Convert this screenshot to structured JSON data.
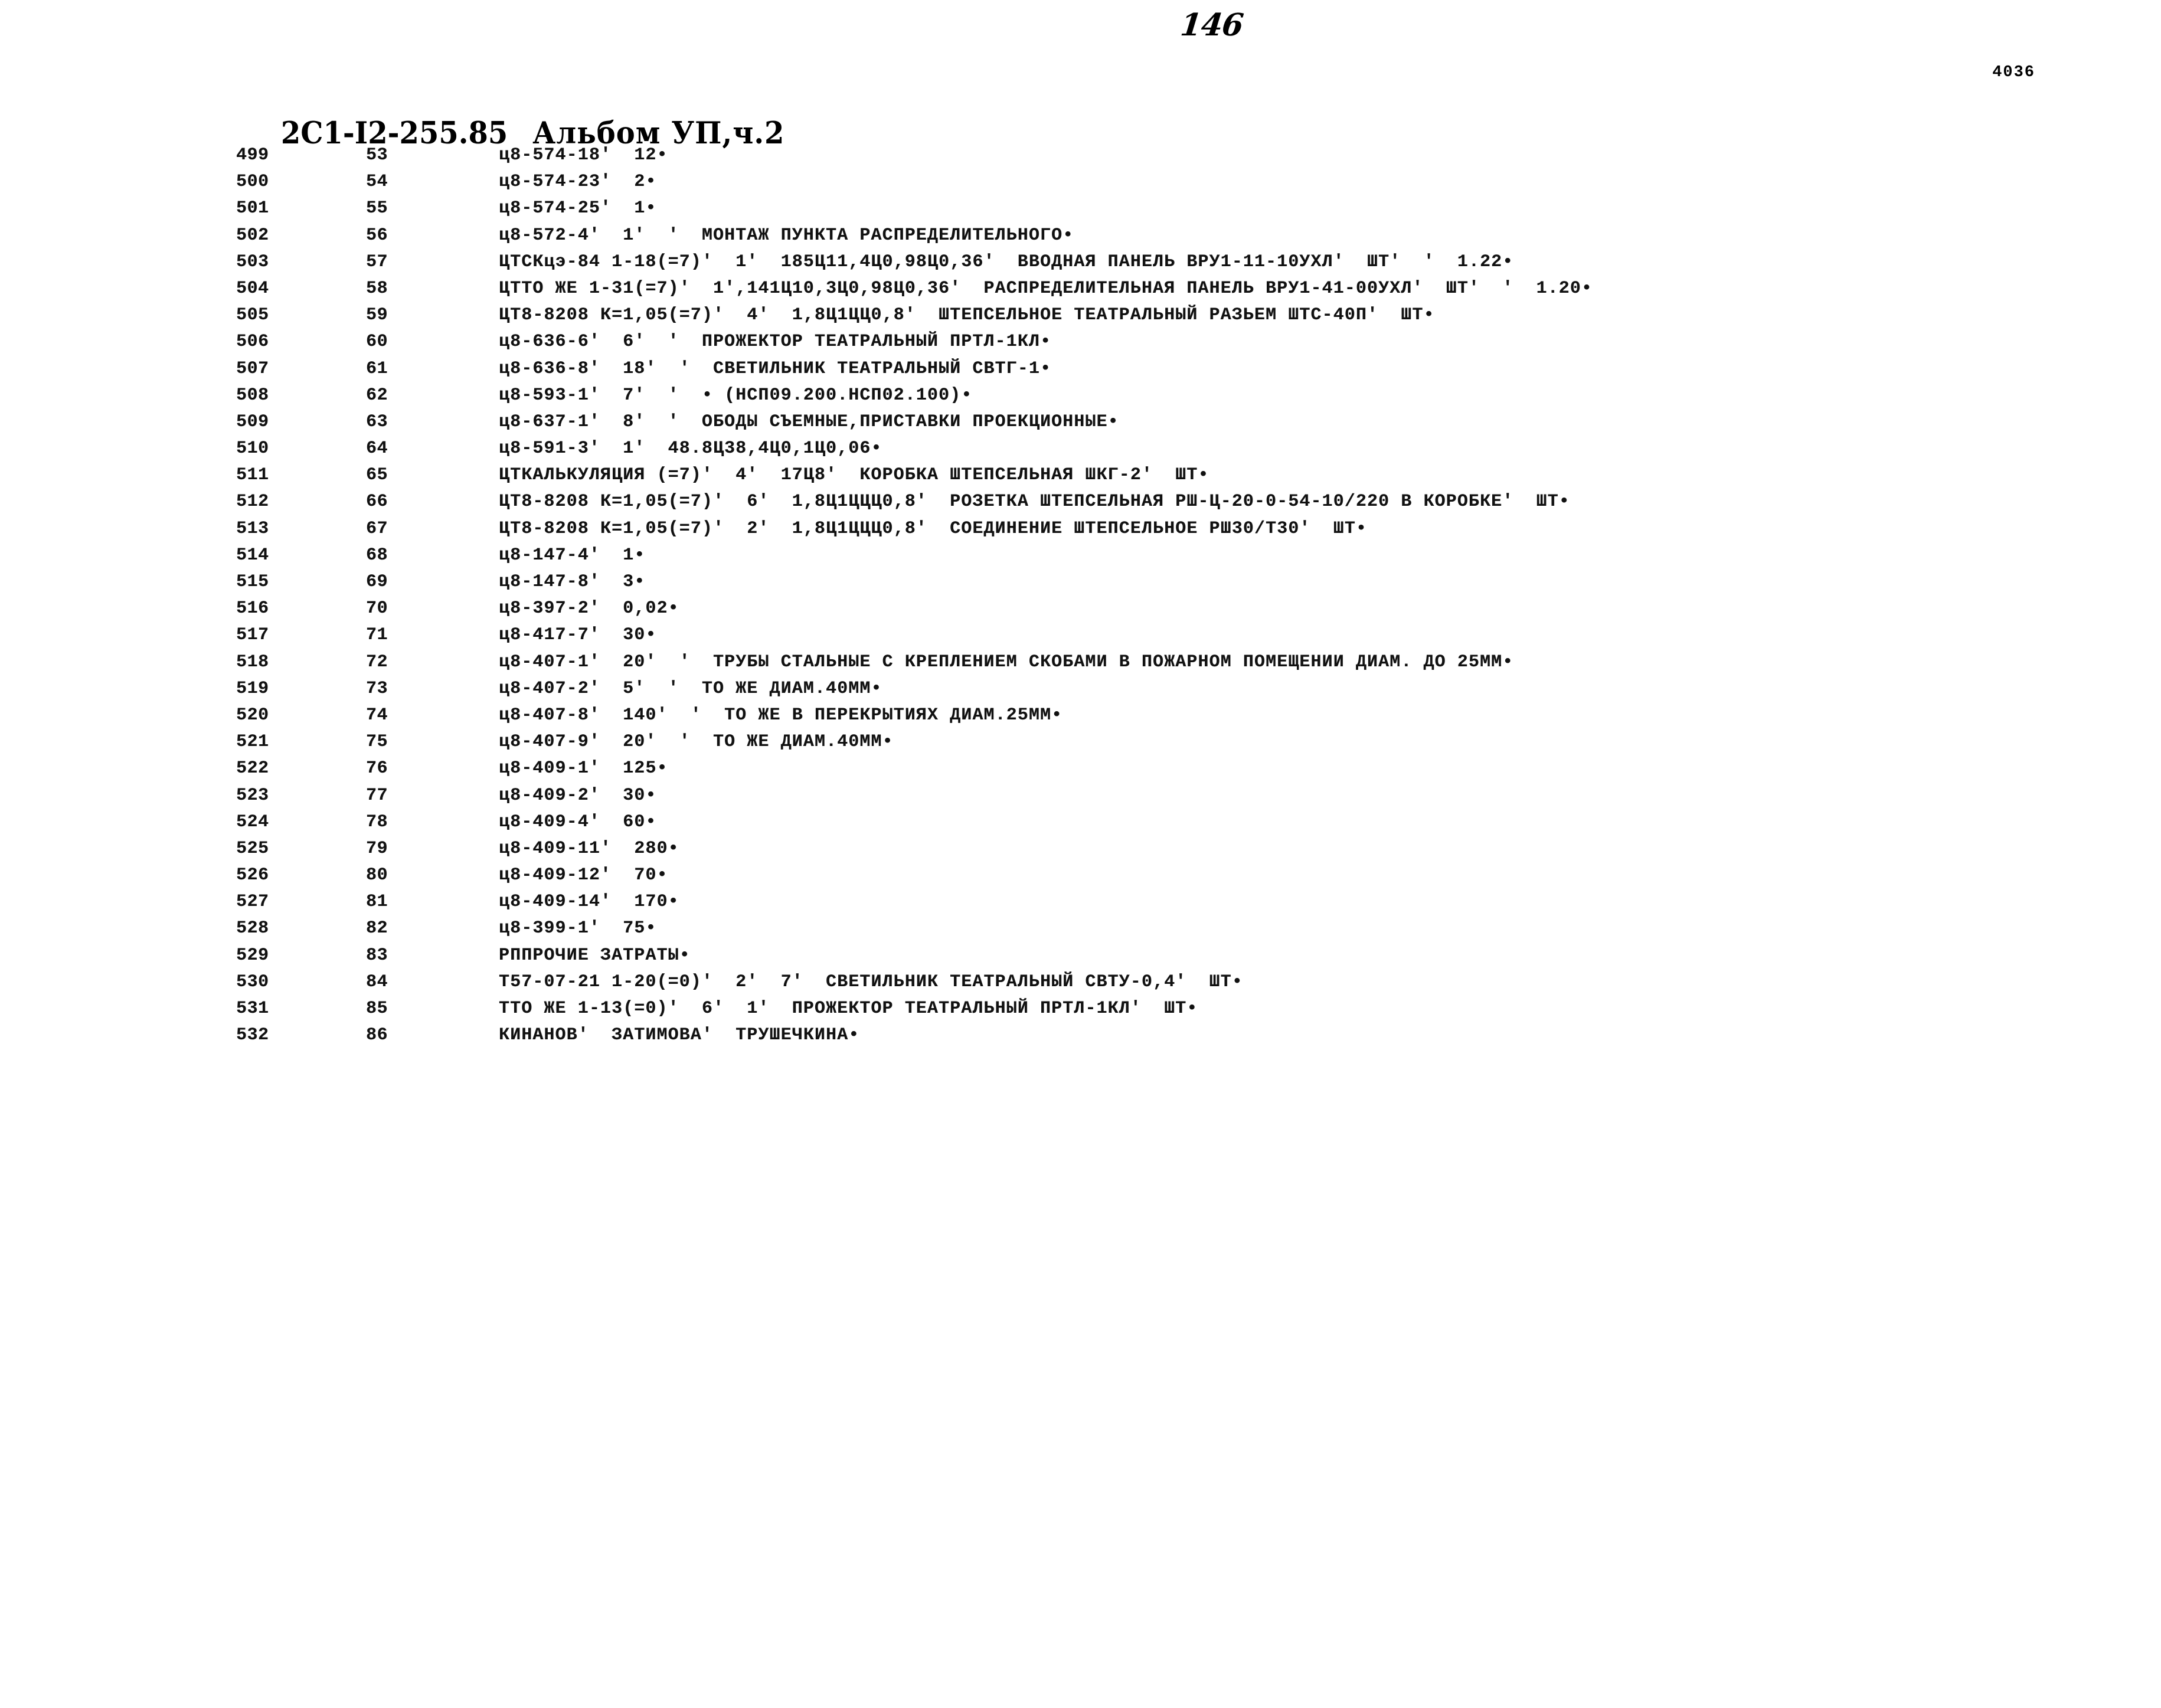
{
  "document": {
    "title_code": "2С1-I2-255.85",
    "title_album": "Альбом УП,ч.2",
    "page_number_handwritten": "146",
    "corner_code": "4036"
  },
  "listing": {
    "rows": [
      {
        "seq": "499",
        "num": "53",
        "text": "ц8-574-18'  12•"
      },
      {
        "seq": "500",
        "num": "54",
        "text": "ц8-574-23'  2•"
      },
      {
        "seq": "501",
        "num": "55",
        "text": "ц8-574-25'  1•"
      },
      {
        "seq": "502",
        "num": "56",
        "text": "ц8-572-4'  1'  '  МОНТАЖ ПУНКТА РАСПРЕДЕЛИТЕЛЬНОГО•"
      },
      {
        "seq": "503",
        "num": "57",
        "text": "ЦТСКцэ-84 1-18(=7)'  1'  185Ц11,4Ц0,98Ц0,36'  ВВОДНАЯ ПАНЕЛЬ ВРУ1-11-10УХЛ'  ШТ'  '  1.22•"
      },
      {
        "seq": "504",
        "num": "58",
        "text": "ЦТТО ЖЕ 1-31(=7)'  1',141Ц10,3Ц0,98Ц0,36'  РАСПРЕДЕЛИТЕЛЬНАЯ ПАНЕЛЬ ВРУ1-41-00УХЛ'  ШТ'  '  1.20•"
      },
      {
        "seq": "505",
        "num": "59",
        "text": "ЦТ8-8208 К=1,05(=7)'  4'  1,8Ц1ЦЦ0,8'  ШТЕПСЕЛЬНОЕ ТЕАТРАЛЬНЫЙ РАЗЬЕМ ШТС-40П'  ШТ•"
      },
      {
        "seq": "506",
        "num": "60",
        "text": "ц8-636-6'  6'  '  ПРОЖЕКТОР ТЕАТРАЛЬНЫЙ ПРТЛ-1КЛ•"
      },
      {
        "seq": "507",
        "num": "61",
        "text": "ц8-636-8'  18'  '  СВЕТИЛЬНИК ТЕАТРАЛЬНЫЙ СВТГ-1•"
      },
      {
        "seq": "508",
        "num": "62",
        "text": "ц8-593-1'  7'  '  • (НСП09.200.НСП02.100)•"
      },
      {
        "seq": "509",
        "num": "63",
        "text": "ц8-637-1'  8'  '  ОБОДЫ СЪЕМНЫЕ,ПРИСТАВКИ ПРОЕКЦИОННЫЕ•"
      },
      {
        "seq": "510",
        "num": "64",
        "text": "ц8-591-3'  1'  48.8Ц38,4Ц0,1Ц0,06•"
      },
      {
        "seq": "511",
        "num": "65",
        "text": "ЦТКАЛЬКУЛЯЦИЯ (=7)'  4'  17Ц8'  КОРОБКА ШТЕПСЕЛЬНАЯ ШКГ-2'  ШТ•"
      },
      {
        "seq": "512",
        "num": "66",
        "text": "ЦТ8-8208 К=1,05(=7)'  6'  1,8Ц1ЦЦЦ0,8'  РОЗЕТКА ШТЕПСЕЛЬНАЯ РШ-Ц-20-0-54-10/220 В КОРОБКЕ'  ШТ•"
      },
      {
        "seq": "513",
        "num": "67",
        "text": "ЦТ8-8208 К=1,05(=7)'  2'  1,8Ц1ЦЦЦ0,8'  СОЕДИНЕНИЕ ШТЕПСЕЛЬНОЕ РШ30/Т30'  ШТ•"
      },
      {
        "seq": "514",
        "num": "68",
        "text": "ц8-147-4'  1•"
      },
      {
        "seq": "515",
        "num": "69",
        "text": "ц8-147-8'  3•"
      },
      {
        "seq": "516",
        "num": "70",
        "text": "ц8-397-2'  0,02•"
      },
      {
        "seq": "517",
        "num": "71",
        "text": "ц8-417-7'  30•"
      },
      {
        "seq": "518",
        "num": "72",
        "text": "ц8-407-1'  20'  '  ТРУБЫ СТАЛЬНЫЕ С КРЕПЛЕНИЕМ СКОБАМИ В ПОЖАРНОМ ПОМЕЩЕНИИ ДИАМ. ДО 25ММ•"
      },
      {
        "seq": "519",
        "num": "73",
        "text": "ц8-407-2'  5'  '  ТО ЖЕ ДИАМ.40ММ•"
      },
      {
        "seq": "520",
        "num": "74",
        "text": "ц8-407-8'  140'  '  ТО ЖЕ В ПЕРЕКРЫТИЯХ ДИАМ.25ММ•"
      },
      {
        "seq": "521",
        "num": "75",
        "text": "ц8-407-9'  20'  '  ТО ЖЕ ДИАМ.40ММ•"
      },
      {
        "seq": "522",
        "num": "76",
        "text": "ц8-409-1'  125•"
      },
      {
        "seq": "523",
        "num": "77",
        "text": "ц8-409-2'  30•"
      },
      {
        "seq": "524",
        "num": "78",
        "text": "ц8-409-4'  60•"
      },
      {
        "seq": "525",
        "num": "79",
        "text": "ц8-409-11'  280•"
      },
      {
        "seq": "526",
        "num": "80",
        "text": "ц8-409-12'  70•"
      },
      {
        "seq": "527",
        "num": "81",
        "text": "ц8-409-14'  170•"
      },
      {
        "seq": "528",
        "num": "82",
        "text": "ц8-399-1'  75•"
      },
      {
        "seq": "529",
        "num": "83",
        "text": "РППРОЧИЕ ЗАТРАТЫ•"
      },
      {
        "seq": "530",
        "num": "84",
        "text": "Т57-07-21 1-20(=0)'  2'  7'  СВЕТИЛЬНИК ТЕАТРАЛЬНЫЙ СВТУ-0,4'  ШТ•"
      },
      {
        "seq": "531",
        "num": "85",
        "text": "ТТО ЖЕ 1-13(=0)'  6'  1'  ПРОЖЕКТОР ТЕАТРАЛЬНЫЙ ПРТЛ-1КЛ'  ШТ•"
      },
      {
        "seq": "532",
        "num": "86",
        "text": "КИНАНОВ'  ЗАТИМОВА'  ТРУШЕЧКИНА•"
      }
    ]
  }
}
